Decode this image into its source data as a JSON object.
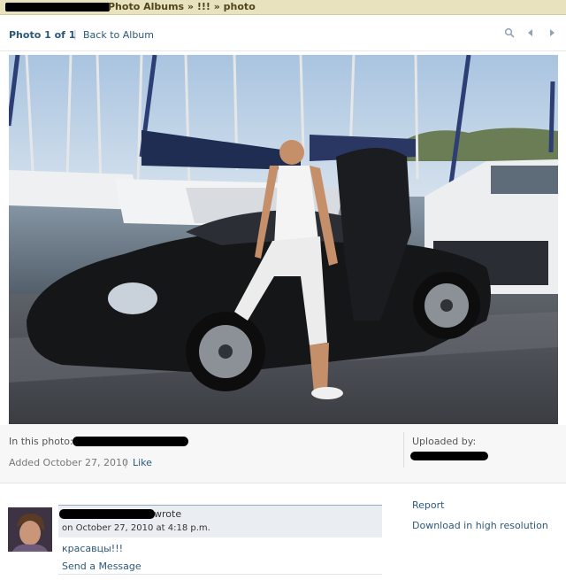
{
  "breadcrumb": {
    "text": "Photo Albums » !!! » photo"
  },
  "nav": {
    "count": "Photo 1 of 1",
    "separator": "|",
    "back_label": "Back to Album",
    "icons": [
      "search-icon",
      "chevron-left-icon",
      "chevron-right-icon"
    ]
  },
  "info": {
    "in_photo_label": "In this photo:",
    "added_label": "Added October 27, 2010",
    "separator": "|",
    "like_label": "Like",
    "uploaded_label": "Uploaded by:"
  },
  "comment": {
    "wrote": "wrote",
    "date": "on October 27, 2010 at 4:18 p.m.",
    "text": "красавцы!!!",
    "send_message": "Send a Message"
  },
  "actions": {
    "report": "Report",
    "download": "Download in high resolution"
  },
  "colors": {
    "link": "#2b587a",
    "breadcrumb_bg": "#e9e2bf",
    "info_bg": "#f7f7f7",
    "comment_header_bg": "#eaeef3"
  }
}
